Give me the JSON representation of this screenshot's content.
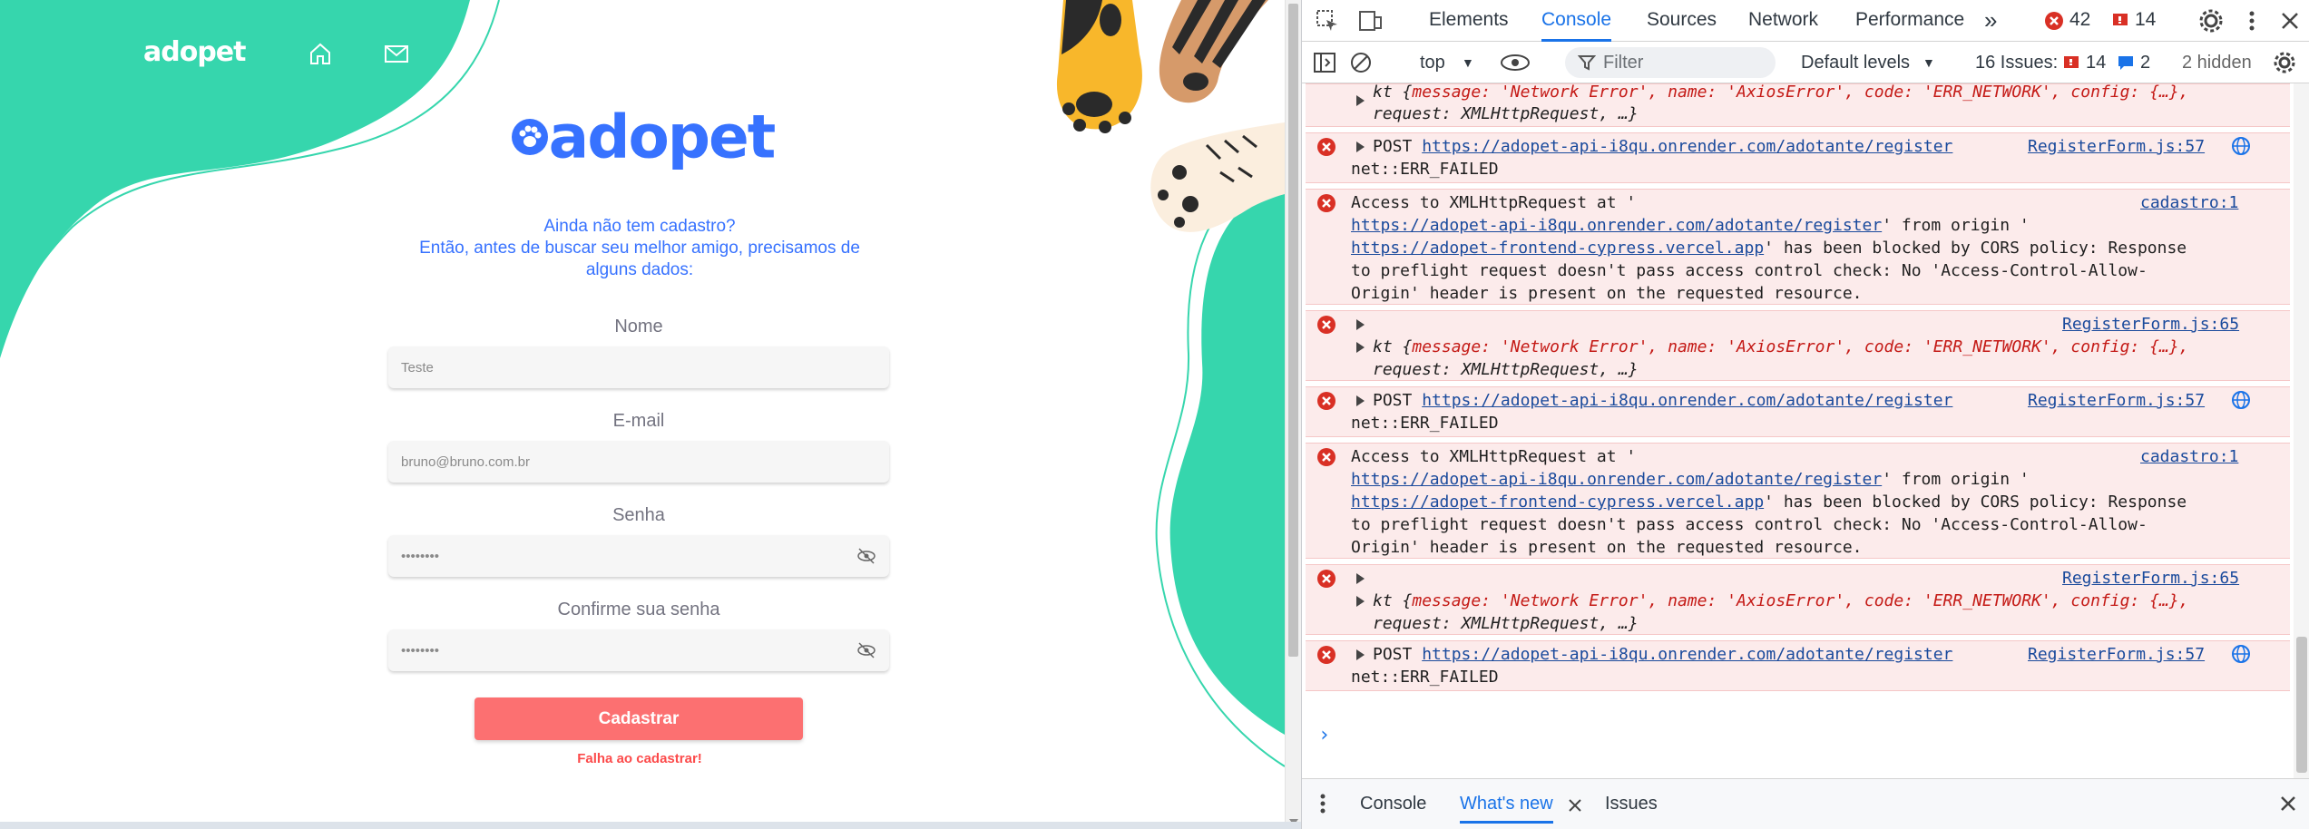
{
  "page": {
    "nav_logo": "adopet",
    "brand": "adopet",
    "intro_line1": "Ainda não tem cadastro?",
    "intro_line2": "Então, antes de buscar seu melhor amigo, precisamos de",
    "intro_line3": "alguns dados:",
    "fields": [
      {
        "label": "Nome",
        "value": "Teste"
      },
      {
        "label": "E-mail",
        "value": "bruno@bruno.com.br"
      },
      {
        "label": "Senha",
        "value": "••••••••"
      },
      {
        "label": "Confirme sua senha",
        "value": "••••••••"
      }
    ],
    "submit_label": "Cadastrar",
    "error_message": "Falha ao cadastrar!",
    "colors": {
      "primary": "#3772ff",
      "accent": "#36d6ad",
      "button": "#fc7071",
      "error": "#fc4b4b"
    }
  },
  "devtools": {
    "tabs": [
      "Elements",
      "Console",
      "Sources",
      "Network",
      "Performance"
    ],
    "active_tab": "Console",
    "error_count": "42",
    "issue_flag_count": "14",
    "context": "top",
    "filter_placeholder": "Filter",
    "levels": "Default levels",
    "issues_label": "16 Issues:",
    "issues_errors": "14",
    "issues_info": "2",
    "hidden_label": "2 hidden",
    "messages": {
      "kt_prefix": "kt {",
      "kt_line1": "message: 'Network Error', name: 'AxiosError', code: 'ERR_NETWORK', config: {…},",
      "kt_line2": "request: XMLHttpRequest, …}",
      "post_label": "POST",
      "post_url": "https://adopet-api-i8qu.onrender.com/adotante/register",
      "post_src": "RegisterForm.js:57",
      "net_failed": "net::ERR_FAILED",
      "cors_line1": "Access to XMLHttpRequest at '",
      "cors_url": "https://adopet-api-i8qu.onrender.com/adotante/register",
      "cors_line2_tail": "' from origin '",
      "cors_origin": "https://adopet-frontend-cypress.vercel.app",
      "cors_line3_tail": "' has been blocked by CORS policy: Response",
      "cors_line4": "to preflight request doesn't pass access control check: No 'Access-Control-Allow-",
      "cors_line5": "Origin' header is present on the requested resource.",
      "cors_src": "cadastro:1",
      "kt_src": "RegisterForm.js:65"
    },
    "drawer_tabs": [
      "Console",
      "What's new",
      "Issues"
    ],
    "drawer_active": "What's new"
  }
}
